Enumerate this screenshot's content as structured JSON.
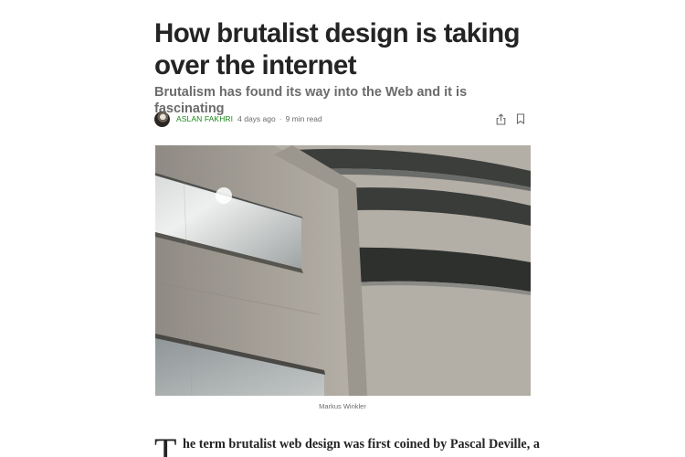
{
  "article": {
    "title": "How brutalist design is taking over the internet",
    "subtitle": "Brutalism has found its way into the Web and it is fascinating",
    "meta": {
      "author": "ASLAN FAKHRI",
      "date": "4 days ago",
      "separator": "·",
      "read_time": "9 min read"
    },
    "actions": {
      "share_icon": "share-icon",
      "bookmark_icon": "bookmark-icon"
    },
    "image": {
      "caption": "Markus Winkler"
    },
    "body": {
      "dropcap": "T",
      "first_line_part1": "he term brutalist web design was first coined by ",
      "first_line_name": "Pascal Deville",
      "first_line_part2": ", a"
    }
  },
  "colors": {
    "title": "#242424",
    "subtitle": "#6b6b6b",
    "author": "#1a8917",
    "concrete": "#9c978f"
  }
}
